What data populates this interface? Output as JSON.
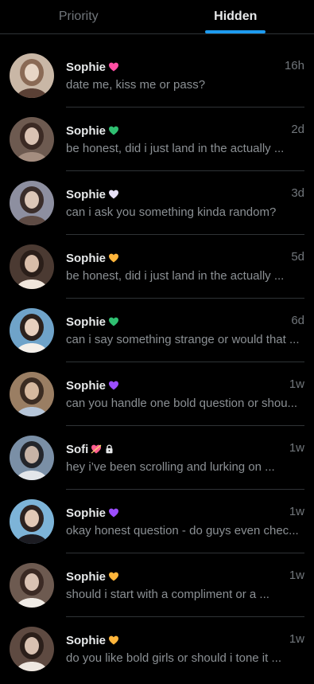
{
  "tabs": [
    {
      "label": "Priority",
      "active": false
    },
    {
      "label": "Hidden",
      "active": true
    }
  ],
  "colors": {
    "accent": "#1d9bf0",
    "background": "#000000",
    "divider": "#2f3336",
    "muted_text": "#71767b"
  },
  "conversations": [
    {
      "name": "Sophie",
      "badge": "pink-heart-icon",
      "badge_color": "#ff4fa3",
      "locked": false,
      "time": "16h",
      "preview": "date me, kiss me or pass?"
    },
    {
      "name": "Sophie",
      "badge": "green-heart-icon",
      "badge_color": "#2fbf71",
      "locked": false,
      "time": "2d",
      "preview": "be honest, did i just land in the actually ..."
    },
    {
      "name": "Sophie",
      "badge": "white-heart-icon",
      "badge_color": "#e6e0f5",
      "locked": false,
      "time": "3d",
      "preview": "can i ask you something kinda random?"
    },
    {
      "name": "Sophie",
      "badge": "yellow-heart-icon",
      "badge_color": "#ffb53b",
      "locked": false,
      "time": "5d",
      "preview": "be honest, did i just land in the actually ..."
    },
    {
      "name": "Sophie",
      "badge": "green-heart-icon",
      "badge_color": "#2fbf71",
      "locked": false,
      "time": "6d",
      "preview": "can i say something strange or would that ..."
    },
    {
      "name": "Sophie",
      "badge": "purple-heart-icon",
      "badge_color": "#9b4dff",
      "locked": false,
      "time": "1w",
      "preview": "can you handle one bold question or shou..."
    },
    {
      "name": "Sofi",
      "badge": "heart-with-arrow-icon",
      "badge_color": "#ff5d8f",
      "locked": true,
      "time": "1w",
      "preview": "hey i’ve been scrolling and lurking on ..."
    },
    {
      "name": "Sophie",
      "badge": "purple-heart-icon",
      "badge_color": "#9b4dff",
      "locked": false,
      "time": "1w",
      "preview": "okay honest question - do guys even chec..."
    },
    {
      "name": "Sophie",
      "badge": "yellow-heart-icon",
      "badge_color": "#ffb53b",
      "locked": false,
      "time": "1w",
      "preview": "should i start with a compliment or a ..."
    },
    {
      "name": "Sophie",
      "badge": "yellow-heart-icon",
      "badge_color": "#ffb53b",
      "locked": false,
      "time": "1w",
      "preview": "do you like bold girls or should i tone it ..."
    }
  ]
}
